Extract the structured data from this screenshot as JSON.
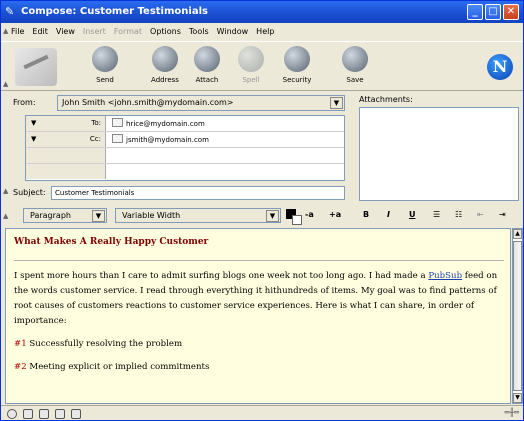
{
  "window": {
    "title": "Compose: Customer Testimonials"
  },
  "menu": [
    {
      "label": "File",
      "disabled": false
    },
    {
      "label": "Edit",
      "disabled": false
    },
    {
      "label": "View",
      "disabled": false
    },
    {
      "label": "Insert",
      "disabled": true
    },
    {
      "label": "Format",
      "disabled": true
    },
    {
      "label": "Options",
      "disabled": false
    },
    {
      "label": "Tools",
      "disabled": false
    },
    {
      "label": "Window",
      "disabled": false
    },
    {
      "label": "Help",
      "disabled": false
    }
  ],
  "toolbar": {
    "send": "Send",
    "address": "Address",
    "attach": "Attach",
    "spell": "Spell",
    "security": "Security",
    "save": "Save",
    "brand_letter": "N"
  },
  "header": {
    "from_label": "From:",
    "from_value": "John Smith <john.smith@mydomain.com>",
    "recipients": [
      {
        "type": "To:",
        "address": "hrice@mydomain.com"
      },
      {
        "type": "Cc:",
        "address": "jsmith@mydomain.com"
      }
    ],
    "subject_label": "Subject:",
    "subject_value": "Customer Testimonials",
    "attachments_label": "Attachments:"
  },
  "format": {
    "paragraph": "Paragraph",
    "font": "Variable Width",
    "smaller": "-a",
    "larger": "+a",
    "bold": "B",
    "italic": "I",
    "underline": "U"
  },
  "body": {
    "heading": "What Makes A Really Happy Customer",
    "para1_before": "I spent more hours than I care to admit surfing blogs one week not too long ago. I had made a ",
    "para1_link": "PubSub",
    "para1_after": " feed on the words customer service. I read through everything it hithundreds of items. My goal was to find patterns of root causes of customers reactions to customer service experiences. Here is what I can share, in order of importance:",
    "items": [
      {
        "num": "#1",
        "text": " Successfully resolving the problem"
      },
      {
        "num": "#2",
        "text": " Meeting explicit or implied commitments"
      }
    ]
  },
  "colors": {
    "title_bar": "#1a4ed0",
    "heading": "#800000",
    "editor_bg": "#ffffe0",
    "link": "#1c3fb0",
    "number": "#b00000"
  }
}
